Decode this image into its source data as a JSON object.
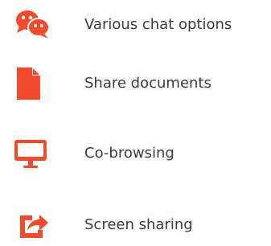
{
  "brand_color": "#f24a2a",
  "features": [
    {
      "label": "Various chat options",
      "icon": "chat-bubbles-icon"
    },
    {
      "label": "Share documents",
      "icon": "document-icon"
    },
    {
      "label": "Co-browsing",
      "icon": "monitor-icon"
    },
    {
      "label": "Screen sharing",
      "icon": "share-arrow-icon"
    }
  ]
}
